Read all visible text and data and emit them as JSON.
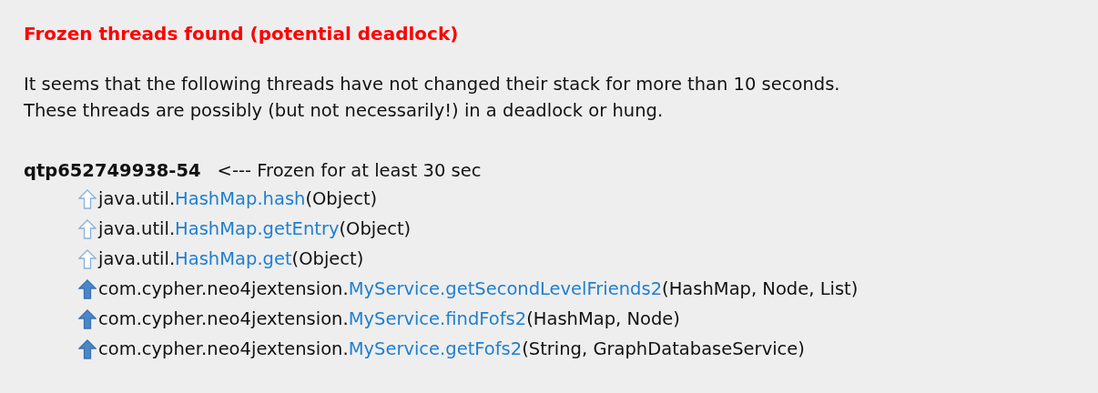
{
  "title": "Frozen threads found (potential deadlock)",
  "description": [
    "It seems that the following threads have not changed their stack for more than 10 seconds.",
    "These threads are possibly (but not necessarily!) in a deadlock or hung."
  ],
  "thread": {
    "name": "qtp652749938-54",
    "note": "<--- Frozen for at least 30 sec"
  },
  "frames": [
    {
      "kind": "library",
      "package": "java.util.",
      "method": "HashMap.hash",
      "params": "(Object)"
    },
    {
      "kind": "library",
      "package": "java.util.",
      "method": "HashMap.getEntry",
      "params": "(Object)"
    },
    {
      "kind": "library",
      "package": "java.util.",
      "method": "HashMap.get",
      "params": "(Object)"
    },
    {
      "kind": "app",
      "package": "com.cypher.neo4jextension.",
      "method": "MyService.getSecondLevelFriends2",
      "params": "(HashMap, Node, List)"
    },
    {
      "kind": "app",
      "package": "com.cypher.neo4jextension.",
      "method": "MyService.findFofs2",
      "params": "(HashMap, Node)"
    },
    {
      "kind": "app",
      "package": "com.cypher.neo4jextension.",
      "method": "MyService.getFofs2",
      "params": "(String, GraphDatabaseService)"
    }
  ]
}
